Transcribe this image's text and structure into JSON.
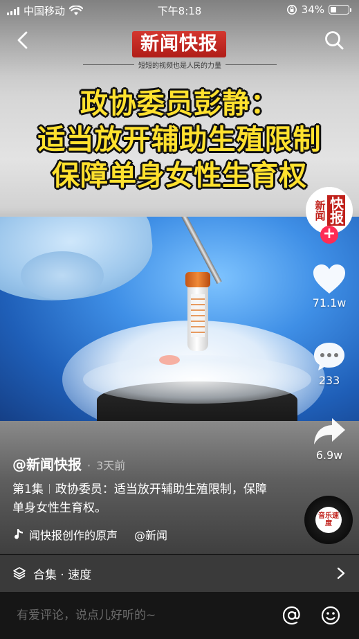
{
  "status_bar": {
    "carrier": "中国移动",
    "time": "下午8:18",
    "battery_percent": "34%",
    "battery_level": 0.34
  },
  "nav": {
    "back_icon": "chevron-left-icon",
    "search_icon": "search-icon"
  },
  "video": {
    "brand_name": "新闻快报",
    "brand_tagline": "短短的视频也是人民的力量",
    "headline": [
      "政协委员彭静：",
      "适当放开辅助生殖限制",
      "保障单身女性生育权"
    ]
  },
  "rail": {
    "avatar_logo": {
      "left": "新闻",
      "right": "快报"
    },
    "follow_label": "+",
    "likes": "71.1w",
    "comments": "233",
    "shares": "6.9w",
    "music_disc_text": "音乐速度"
  },
  "caption": {
    "author": "@新闻快报",
    "dot": "·",
    "posted": "3天前",
    "episode": "第1集",
    "text": "政协委员：适当放开辅助生殖限制，保障单身女性生育权。",
    "music": "闻快报创作的原声",
    "music_author": "@新闻"
  },
  "collection": {
    "label": "合集 · 速度"
  },
  "comment_bar": {
    "placeholder": "有爱评论，说点儿好听的~"
  },
  "colors": {
    "headline_yellow": "#ffe12e",
    "brand_red": "#c0201a",
    "follow_pink": "#fe2c55"
  }
}
